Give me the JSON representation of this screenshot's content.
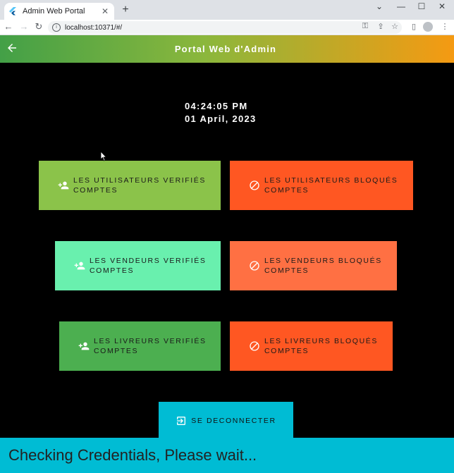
{
  "browser": {
    "tab_title": "Admin Web Portal",
    "tab_close": "✕",
    "new_tab": "+",
    "url": "localhost:10371/#/",
    "window_controls": [
      "⌄",
      "—",
      "☐",
      "✕"
    ]
  },
  "app": {
    "title": "Portal Web d'Admin",
    "back_icon": "arrow-back-icon",
    "clock_time": "04:24:05 PM",
    "clock_date": "01 April, 2023",
    "buttons": [
      {
        "label": "Les utilisateurs verifiés\ncomptes",
        "icon": "person-add-icon",
        "color": "#8bc34a"
      },
      {
        "label": "Les utilisateurs bloqués\ncomptes",
        "icon": "block-icon",
        "color": "#ff5722"
      },
      {
        "label": "Les vendeurs verifiés\ncomptes",
        "icon": "person-add-icon",
        "color": "#69f0ae"
      },
      {
        "label": "Les vendeurs bloqués\ncomptes",
        "icon": "block-icon",
        "color": "#ff7043"
      },
      {
        "label": "Les livreurs verifiés\ncomptes",
        "icon": "person-add-icon",
        "color": "#4caf50"
      },
      {
        "label": "Les livreurs bloqués\ncomptes",
        "icon": "block-icon",
        "color": "#ff5722"
      }
    ],
    "logout_label": "SE DECONNECTER",
    "logout_color": "#00bcd4",
    "snackbar_text": "Checking Credentials, Please wait..."
  }
}
